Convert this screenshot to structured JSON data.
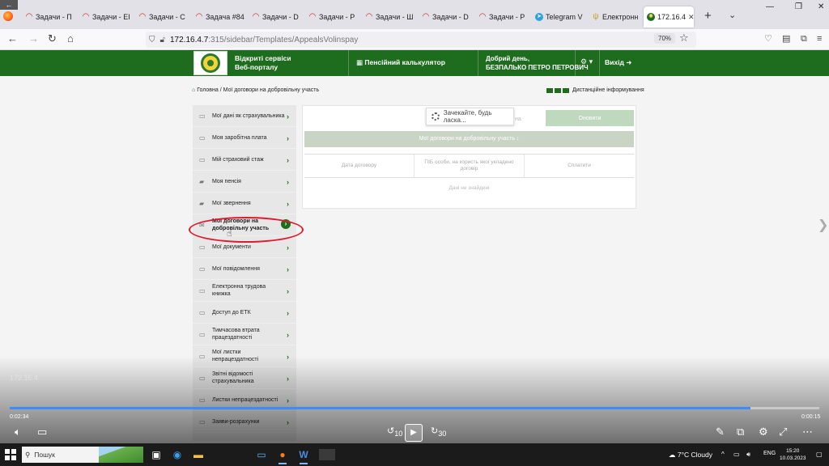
{
  "browser": {
    "back_badge": "←",
    "tabs": [
      {
        "label": "Задачи - П",
        "icon": "arc-red-icon"
      },
      {
        "label": "Задачи - ЕІ",
        "icon": "arc-red-icon"
      },
      {
        "label": "Задачи - С",
        "icon": "arc-red-icon"
      },
      {
        "label": "Задача #84",
        "icon": "arc-red-icon"
      },
      {
        "label": "Задачи - D",
        "icon": "arc-red-icon"
      },
      {
        "label": "Задачи - Р",
        "icon": "arc-red-icon"
      },
      {
        "label": "Задачи - Ш",
        "icon": "arc-red-icon"
      },
      {
        "label": "Задачи - D",
        "icon": "arc-red-icon"
      },
      {
        "label": "Задачи - Р",
        "icon": "arc-red-icon"
      },
      {
        "label": "Telegram V",
        "icon": "telegram-icon"
      },
      {
        "label": "Електронн",
        "icon": "trident-icon"
      },
      {
        "label": "172.16.4",
        "icon": "site-emblem-icon",
        "active": true
      }
    ],
    "address": {
      "host": "172.16.4.7",
      "path": ":315/sidebar/Templates/AppealsVolinspay"
    },
    "zoom": "70%"
  },
  "header": {
    "brand_line1": "Відкриті сервіси",
    "brand_line2": "Веб-порталу",
    "calculator_label": "Пенсійний калькулятор",
    "greeting_line1": "Добрий день,",
    "greeting_line2": "БЕЗПАЛЬКО ПЕТРО ПЕТРОВИЧ",
    "exit_label": "Вихід"
  },
  "breadcrumb": {
    "home": "Головна",
    "current": "Мої договори на добровільну участь"
  },
  "remote_info": "Дистанційне інформування",
  "sidebar": {
    "items": [
      {
        "label": "Мої дані як страхувальника"
      },
      {
        "label": "Моя заробітна плата"
      },
      {
        "label": "Мій страховий стаж"
      },
      {
        "label": "Моя пенсія"
      },
      {
        "label": "Мої звернення"
      },
      {
        "label": "Мої договори на добровільну участь",
        "active": true
      },
      {
        "label": "Мої документи"
      },
      {
        "label": "Мої повідомлення"
      },
      {
        "label": "Електронна трудова книжка"
      },
      {
        "label": "Доступ до ЕТК"
      },
      {
        "label": "Тимчасова втрата працездатності"
      },
      {
        "label": "Мої листки непрацездатності"
      },
      {
        "label": "Звітні відомості страхувальника"
      },
      {
        "label": "Листки непрацездатності"
      },
      {
        "label": "Заяви-розрахунки"
      }
    ]
  },
  "main": {
    "loading_text": "Зачекайте, будь ласка...",
    "ghost_text": "на",
    "refresh_label": "Оновити",
    "list_title": "Мої договори на добровільну участь ↓",
    "table": {
      "columns": [
        "Дата договору",
        "ПІБ особи, на користь якої укладено договір",
        "Сплатити"
      ],
      "empty": "Дані не знайдені"
    }
  },
  "video": {
    "ghost_time": "172.16.4",
    "current_time": "0:02:34",
    "remaining_time": "0:00:15",
    "progress": 0.915,
    "skip_back": "10",
    "skip_forward": "30"
  },
  "taskbar": {
    "search_placeholder": "Пошук",
    "weather": "7°C  Cloudy",
    "lang": "ENG",
    "time": "15:20",
    "date": "10.03.2023"
  }
}
